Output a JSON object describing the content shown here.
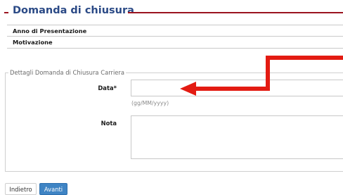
{
  "section": {
    "title": "Domanda di chiusura",
    "rows": [
      "Anno di Presentazione",
      "Motivazione"
    ]
  },
  "details": {
    "legend": "Dettagli Domanda di Chiusura Carriera",
    "date_label": "Data*",
    "date_value": "",
    "date_hint": "(gg/MM/yyyy)",
    "note_label": "Nota",
    "note_value": ""
  },
  "buttons": {
    "back": "Indietro",
    "next": "Avanti"
  },
  "colors": {
    "title": "#2b4a86",
    "rule": "#9b1420",
    "annotation_arrow": "#e31b12",
    "primary_button": "#3f84c4"
  }
}
